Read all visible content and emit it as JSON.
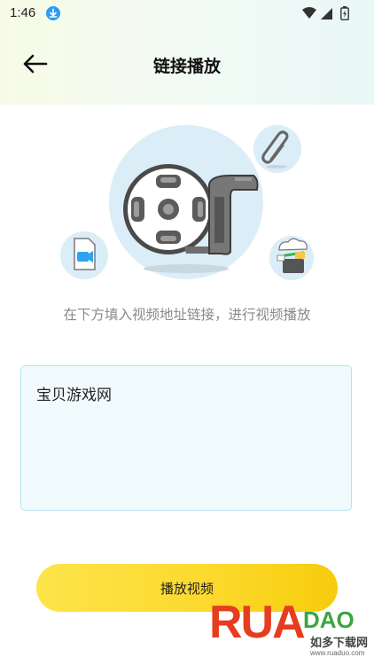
{
  "status_bar": {
    "time": "1:46"
  },
  "header": {
    "title": "链接播放"
  },
  "main": {
    "hint": "在下方填入视频地址链接，进行视频播放",
    "url_input": {
      "value": "宝贝游戏网"
    },
    "play_button_label": "播放视频"
  },
  "watermark": {
    "text_large": "RUA",
    "text_small": "DAO",
    "text_chinese": "如多下载网",
    "url": "www.ruaduo.com"
  },
  "icons": {
    "status": [
      "download-icon",
      "wifi-icon",
      "signal-icon",
      "battery-icon"
    ],
    "header": "arrow-left-icon",
    "illustration": [
      "film-reel-icon",
      "paperclip-icon",
      "video-file-icon",
      "cloud-link-icon"
    ]
  },
  "colors": {
    "accent_yellow": "#fcda2e",
    "input_border": "#b4e4ef",
    "input_bg": "#f1fbfd",
    "illustration_bg": "#dbedf7",
    "download_badge": "#2a9df4"
  }
}
